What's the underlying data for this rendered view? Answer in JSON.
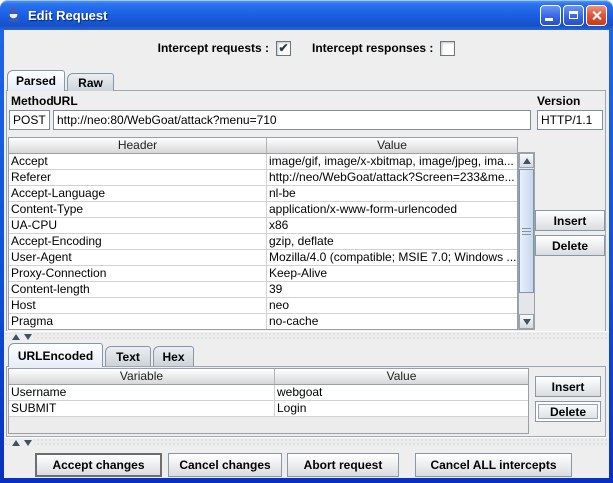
{
  "window": {
    "title": "Edit Request"
  },
  "colors": {
    "titlebar_blue": "#1a5fe4",
    "window_border": "#0f4fd6",
    "close_red": "#d94a2a",
    "content_bg": "#eeeeee",
    "selected_tab_bg": "#e6edf8",
    "table_grid": "#d2d2d2",
    "button_border": "#8a97a5",
    "scrollbar_thumb": "#c6d7ea"
  },
  "intercept": {
    "requests_label": "Intercept requests :",
    "requests_checked": true,
    "requests_check_glyph": "✔",
    "responses_label": "Intercept responses :",
    "responses_checked": false,
    "responses_check_glyph": ""
  },
  "request_tabs": [
    {
      "label": "Parsed",
      "selected": true
    },
    {
      "label": "Raw",
      "selected": false
    }
  ],
  "request_line": {
    "method_label": "Method",
    "method_value": "POST",
    "url_label": "URL",
    "url_value": "http://neo:80/WebGoat/attack?menu=710",
    "version_label": "Version",
    "version_value": "HTTP/1.1"
  },
  "headers_table": {
    "columns": [
      "Header",
      "Value"
    ],
    "rows": [
      [
        "Accept",
        "image/gif, image/x-xbitmap, image/jpeg, ima..."
      ],
      [
        "Referer",
        "http://neo/WebGoat/attack?Screen=233&me..."
      ],
      [
        "Accept-Language",
        "nl-be"
      ],
      [
        "Content-Type",
        "application/x-www-form-urlencoded"
      ],
      [
        "UA-CPU",
        "x86"
      ],
      [
        "Accept-Encoding",
        "gzip, deflate"
      ],
      [
        "User-Agent",
        "Mozilla/4.0 (compatible; MSIE 7.0; Windows ..."
      ],
      [
        "Proxy-Connection",
        "Keep-Alive"
      ],
      [
        "Content-length",
        "39"
      ],
      [
        "Host",
        "neo"
      ],
      [
        "Pragma",
        "no-cache"
      ]
    ],
    "insert_label": "Insert",
    "delete_label": "Delete"
  },
  "content_tabs": [
    {
      "label": "URLEncoded",
      "selected": true
    },
    {
      "label": "Text",
      "selected": false
    },
    {
      "label": "Hex",
      "selected": false
    }
  ],
  "params_table": {
    "columns": [
      "Variable",
      "Value"
    ],
    "rows": [
      [
        "Username",
        "webgoat"
      ],
      [
        "SUBMIT",
        "Login"
      ]
    ],
    "insert_label": "Insert",
    "delete_label": "Delete"
  },
  "footer_buttons": [
    "Accept changes",
    "Cancel changes",
    "Abort request",
    "Cancel ALL intercepts"
  ]
}
